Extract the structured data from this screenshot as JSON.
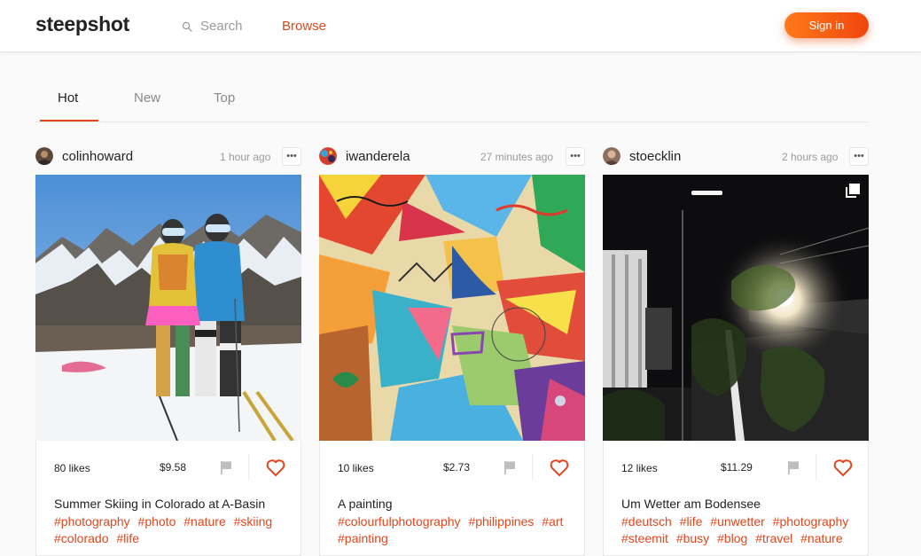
{
  "header": {
    "logo": "steepshot",
    "search_placeholder": "Search",
    "browse_label": "Browse",
    "signin_label": "Sign in"
  },
  "tabs": [
    {
      "label": "Hot",
      "active": true
    },
    {
      "label": "New",
      "active": false
    },
    {
      "label": "Top",
      "active": false
    }
  ],
  "posts": [
    {
      "author": "colinhoward",
      "time": "1 hour ago",
      "likes": "80 likes",
      "payout": "$9.58",
      "title": "Summer Skiing in Colorado at A-Basin",
      "tags": [
        "#photography",
        "#photo",
        "#nature",
        "#skiing",
        "#colorado",
        "#life"
      ]
    },
    {
      "author": "iwanderela",
      "time": "27 minutes ago",
      "likes": "10 likes",
      "payout": "$2.73",
      "title": "A painting",
      "tags": [
        "#colourfulphotography",
        "#philippines",
        "#art",
        "#painting"
      ]
    },
    {
      "author": "stoecklin",
      "time": "2 hours ago",
      "likes": "12 likes",
      "payout": "$11.29",
      "title": "Um Wetter am Bodensee",
      "tags": [
        "#deutsch",
        "#life",
        "#unwetter",
        "#photography",
        "#steemit",
        "#busy",
        "#blog",
        "#travel",
        "#nature"
      ]
    }
  ],
  "colors": {
    "accent": "#e0471d",
    "signin_gradient_start": "#ff7a1a",
    "signin_gradient_end": "#f0450d"
  },
  "icons": {
    "search": "search-icon",
    "menu": "more-dots-icon",
    "flag": "flag-icon",
    "like": "heart-icon",
    "gallery": "gallery-icon"
  }
}
